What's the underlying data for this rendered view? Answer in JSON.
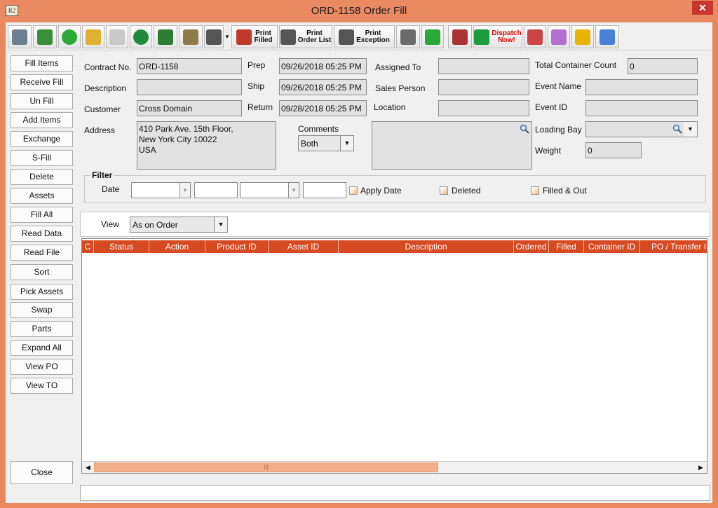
{
  "window": {
    "title": "ORD-1158 Order Fill",
    "app_icon_text": "R2",
    "close_glyph": "✕"
  },
  "toolbar": {
    "buttons": [
      {
        "name": "binoculars-icon",
        "label": "",
        "color": "#6e7f8f"
      },
      {
        "name": "pick-list-icon",
        "label": "",
        "color": "#3a8f3a"
      },
      {
        "name": "refresh-icon",
        "label": "",
        "color": "#2aa83a"
      },
      {
        "name": "edit-note-icon",
        "label": "",
        "color": "#e0b030"
      },
      {
        "name": "funnel-down-icon",
        "label": "",
        "color": "#c9c9c9"
      },
      {
        "name": "zoom-in-icon",
        "label": "",
        "color": "#1f8a3c"
      },
      {
        "name": "filter-check-icon",
        "label": "",
        "color": "#2e7d32"
      },
      {
        "name": "document-stack-icon",
        "label": "",
        "color": "#8d7c4a"
      },
      {
        "name": "print-menu-icon",
        "label": "",
        "color": "#555555"
      },
      {
        "name": "print-filled-icon",
        "label": "Print\nFilled",
        "color": "#c03a2b"
      },
      {
        "name": "print-order-list-icon",
        "label": "Print\nOrder List",
        "color": "#555555"
      },
      {
        "name": "print-exception-icon",
        "label": "Print\nException",
        "color": "#555555"
      },
      {
        "name": "printer-scan-icon",
        "label": "",
        "color": "#6b6b6b"
      },
      {
        "name": "add-remove-icon",
        "label": "",
        "color": "#2aa83a"
      },
      {
        "name": "truck-alert-icon",
        "label": "",
        "color": "#a33"
      },
      {
        "name": "dispatch-now-icon",
        "label": "Dispatch\nNow!",
        "color": "#1e9b3c"
      },
      {
        "name": "document-truck-icon",
        "label": "",
        "color": "#c44"
      },
      {
        "name": "clock-form-icon",
        "label": "",
        "color": "#b16fd0"
      },
      {
        "name": "warning-document-icon",
        "label": "",
        "color": "#e8b400"
      },
      {
        "name": "grid-select-icon",
        "label": "",
        "color": "#4a7fd6"
      }
    ]
  },
  "sidebar": {
    "buttons": [
      "Fill Items",
      "Receive Fill",
      "Un Fill",
      "Add Items",
      "Exchange",
      "S-Fill",
      "Delete",
      "Assets",
      "Fill  All",
      "Read Data",
      "Read File",
      "Sort",
      "Pick Assets",
      "Swap",
      "Parts",
      "Expand All",
      "View PO",
      "View TO"
    ],
    "close": "Close"
  },
  "form": {
    "contract_no_label": "Contract No.",
    "contract_no": "ORD-1158",
    "description_label": "Description",
    "description": "",
    "customer_label": "Customer",
    "customer": "Cross Domain",
    "address_label": "Address",
    "address_line1": "410 Park Ave. 15th Floor,",
    "address_line2": "New York City  10022",
    "address_line3": "USA",
    "prep_label": "Prep",
    "prep": "09/26/2018 05:25 PM",
    "ship_label": "Ship",
    "ship": "09/26/2018 05:25 PM",
    "return_label": "Return",
    "return": "09/28/2018 05:25 PM",
    "comments_label": "Comments",
    "comments_filter": "Both",
    "comments": "",
    "assigned_to_label": "Assigned To",
    "assigned_to": "",
    "sales_person_label": "Sales Person",
    "sales_person": "",
    "location_label": "Location",
    "location": "",
    "total_container_count_label": "Total Container Count",
    "total_container_count": "0",
    "event_name_label": "Event Name",
    "event_name": "",
    "event_id_label": "Event ID",
    "event_id": "",
    "loading_bay_label": "Loading Bay",
    "loading_bay": "",
    "weight_label": "Weight",
    "weight": "0"
  },
  "filter": {
    "title": "Filter",
    "date_label": "Date",
    "apply_date_label": "Apply Date",
    "deleted_label": "Deleted",
    "filled_out_label": "Filled & Out"
  },
  "view": {
    "label": "View",
    "selected": "As on Order"
  },
  "grid": {
    "columns": [
      "C",
      "Status",
      "Action",
      "Product ID",
      "Asset ID",
      "Description",
      "Ordered",
      "Filled",
      "Container ID",
      "PO / Transfer ID"
    ],
    "rows": []
  },
  "colors": {
    "title_bar": "#ea8a63",
    "grid_header": "#d64a21",
    "scroll_thumb": "#f2ae8a"
  }
}
